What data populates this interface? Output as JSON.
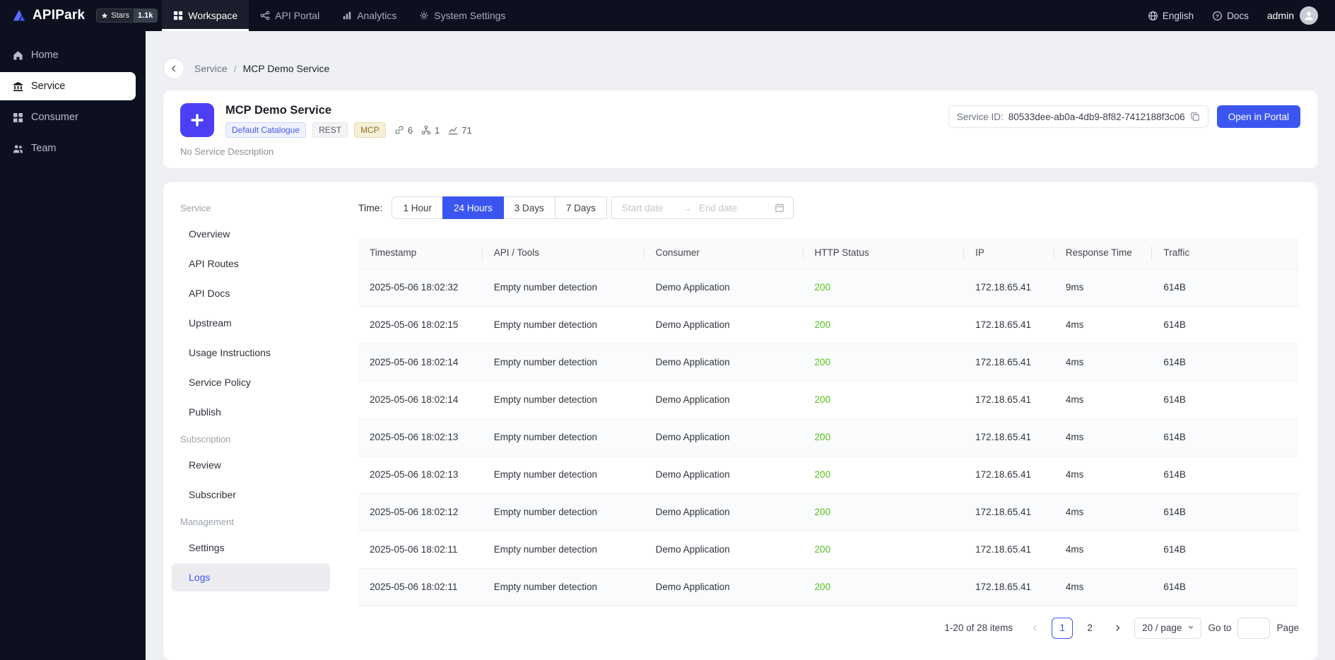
{
  "colors": {
    "accent": "#3b56f0",
    "status_ok": "#52c41a",
    "service_icon_bg": "#4c3ff5",
    "nav_bg": "#0d101f",
    "page_bg": "#eef0f3"
  },
  "topnav": {
    "brand": "APIPark",
    "stars_label": "Stars",
    "stars_count": "1.1k",
    "items": [
      {
        "label": "Workspace",
        "active": true
      },
      {
        "label": "API Portal",
        "active": false
      },
      {
        "label": "Analytics",
        "active": false
      },
      {
        "label": "System Settings",
        "active": false
      }
    ],
    "language": "English",
    "docs": "Docs",
    "user": "admin"
  },
  "sidebar": {
    "items": [
      {
        "label": "Home",
        "active": false
      },
      {
        "label": "Service",
        "active": true
      },
      {
        "label": "Consumer",
        "active": false
      },
      {
        "label": "Team",
        "active": false
      }
    ]
  },
  "breadcrumb": {
    "parent": "Service",
    "separator": "/",
    "current": "MCP Demo Service"
  },
  "service_header": {
    "title": "MCP Demo Service",
    "catalogue_tag": "Default Catalogue",
    "tags": [
      "REST",
      "MCP"
    ],
    "api_count": "6",
    "node_count": "1",
    "traffic_count": "71",
    "description": "No Service Description",
    "service_id_label": "Service ID:",
    "service_id": "80533dee-ab0a-4db9-8f82-7412188f3c06",
    "open_portal_button": "Open in Portal"
  },
  "service_menu": {
    "sections": [
      {
        "title": "Service",
        "items": [
          "Overview",
          "API Routes",
          "API Docs",
          "Upstream",
          "Usage Instructions",
          "Service Policy",
          "Publish"
        ]
      },
      {
        "title": "Subscription",
        "items": [
          "Review",
          "Subscriber"
        ]
      },
      {
        "title": "Management",
        "items": [
          "Settings",
          "Logs"
        ]
      }
    ],
    "active_item": "Logs"
  },
  "filters": {
    "time_label": "Time:",
    "options": [
      "1 Hour",
      "24 Hours",
      "3 Days",
      "7 Days"
    ],
    "active_option": "24 Hours",
    "start_placeholder": "Start date",
    "end_placeholder": "End date",
    "range_arrow": "→"
  },
  "logs_table": {
    "columns": [
      "Timestamp",
      "API / Tools",
      "Consumer",
      "HTTP Status",
      "IP",
      "Response Time",
      "Traffic"
    ],
    "rows": [
      {
        "timestamp": "2025-05-06 18:02:32",
        "api": "Empty number detection",
        "consumer": "Demo Application",
        "status": "200",
        "ip": "172.18.65.41",
        "response_time": "9ms",
        "traffic": "614B"
      },
      {
        "timestamp": "2025-05-06 18:02:15",
        "api": "Empty number detection",
        "consumer": "Demo Application",
        "status": "200",
        "ip": "172.18.65.41",
        "response_time": "4ms",
        "traffic": "614B"
      },
      {
        "timestamp": "2025-05-06 18:02:14",
        "api": "Empty number detection",
        "consumer": "Demo Application",
        "status": "200",
        "ip": "172.18.65.41",
        "response_time": "4ms",
        "traffic": "614B"
      },
      {
        "timestamp": "2025-05-06 18:02:14",
        "api": "Empty number detection",
        "consumer": "Demo Application",
        "status": "200",
        "ip": "172.18.65.41",
        "response_time": "4ms",
        "traffic": "614B"
      },
      {
        "timestamp": "2025-05-06 18:02:13",
        "api": "Empty number detection",
        "consumer": "Demo Application",
        "status": "200",
        "ip": "172.18.65.41",
        "response_time": "4ms",
        "traffic": "614B"
      },
      {
        "timestamp": "2025-05-06 18:02:13",
        "api": "Empty number detection",
        "consumer": "Demo Application",
        "status": "200",
        "ip": "172.18.65.41",
        "response_time": "4ms",
        "traffic": "614B"
      },
      {
        "timestamp": "2025-05-06 18:02:12",
        "api": "Empty number detection",
        "consumer": "Demo Application",
        "status": "200",
        "ip": "172.18.65.41",
        "response_time": "4ms",
        "traffic": "614B"
      },
      {
        "timestamp": "2025-05-06 18:02:11",
        "api": "Empty number detection",
        "consumer": "Demo Application",
        "status": "200",
        "ip": "172.18.65.41",
        "response_time": "4ms",
        "traffic": "614B"
      },
      {
        "timestamp": "2025-05-06 18:02:11",
        "api": "Empty number detection",
        "consumer": "Demo Application",
        "status": "200",
        "ip": "172.18.65.41",
        "response_time": "4ms",
        "traffic": "614B"
      }
    ]
  },
  "pagination": {
    "total_text": "1-20 of 28 items",
    "pages": [
      "1",
      "2"
    ],
    "current_page": "1",
    "page_size": "20 / page",
    "goto_label": "Go to",
    "page_label": "Page"
  }
}
